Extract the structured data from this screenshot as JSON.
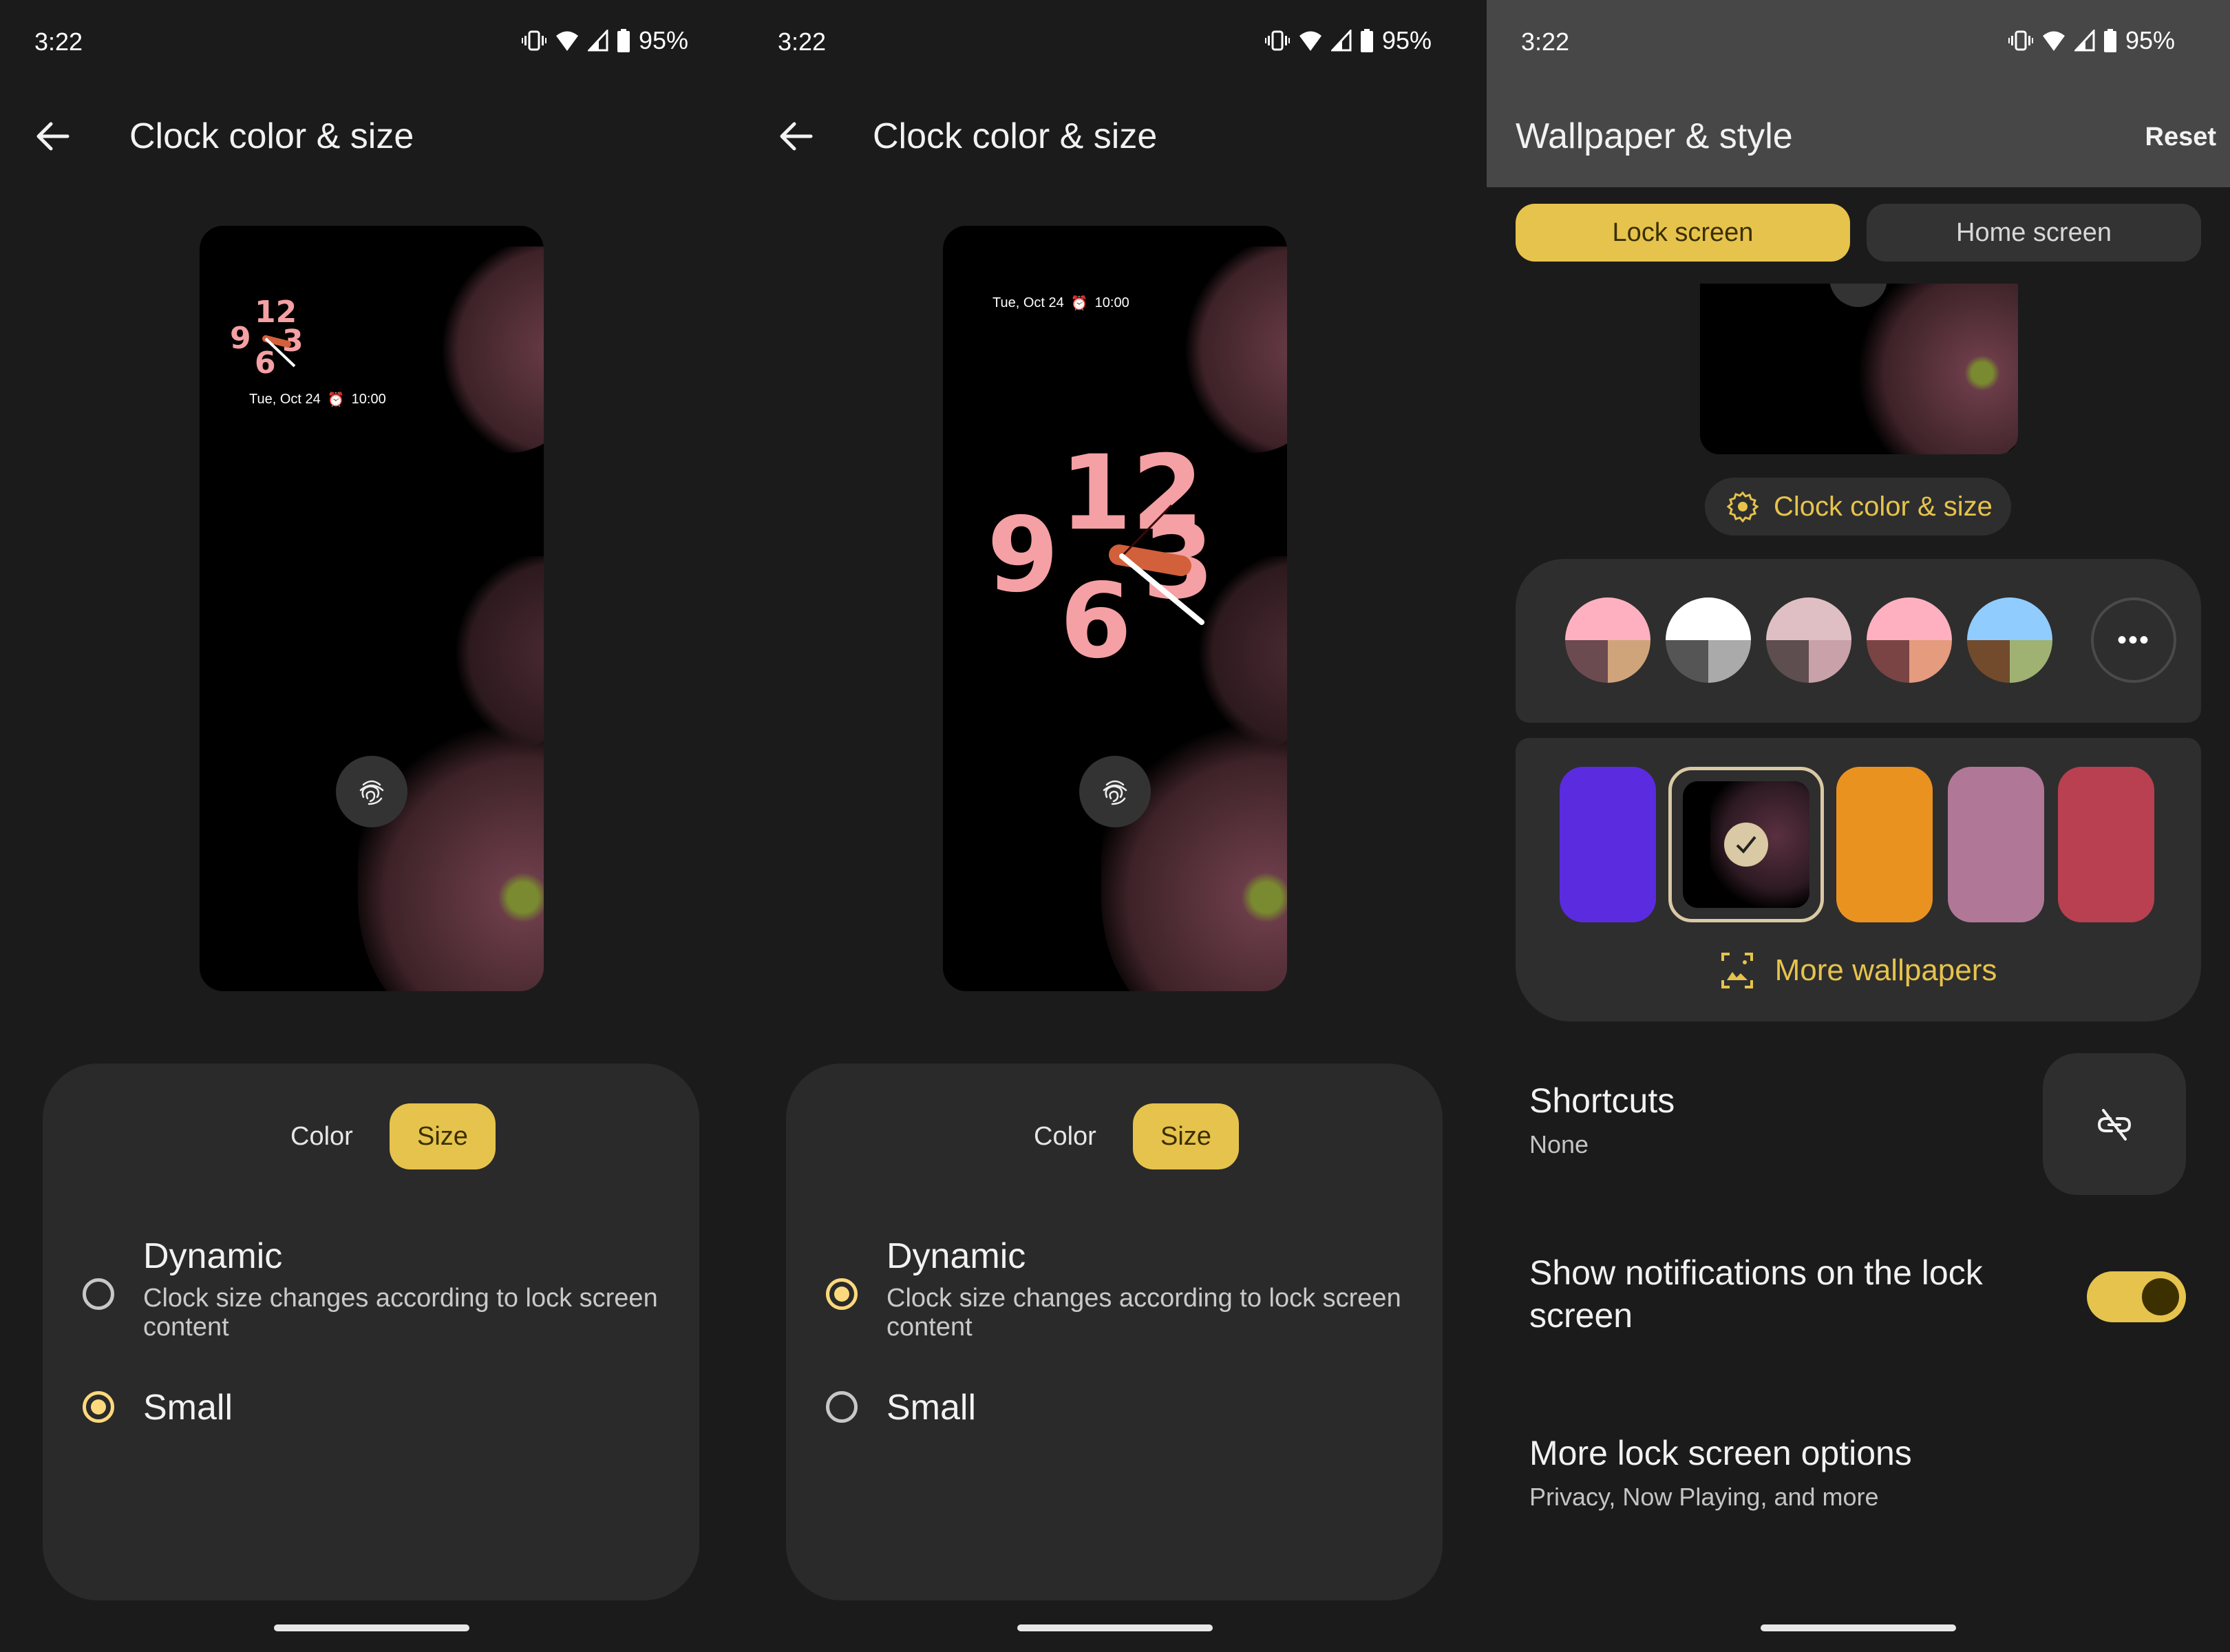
{
  "status_bar": {
    "time": "3:22",
    "battery": "95%",
    "icons": [
      "vibrate-icon",
      "wifi-icon",
      "signal-icon",
      "battery-icon"
    ]
  },
  "accent_color": "#e6c34c",
  "clock_screens": [
    {
      "title": "Clock color & size",
      "preview": {
        "date": "Tue, Oct 24",
        "alarm": "10:00",
        "clock_numerals": [
          "12",
          "9",
          "3",
          "6"
        ],
        "clock_size": "small"
      },
      "tabs": [
        {
          "label": "Color",
          "selected": false
        },
        {
          "label": "Size",
          "selected": true
        }
      ],
      "options": [
        {
          "label": "Dynamic",
          "description": "Clock size changes according to lock screen content",
          "selected": false
        },
        {
          "label": "Small",
          "selected": true
        }
      ]
    },
    {
      "title": "Clock color & size",
      "preview": {
        "date": "Tue, Oct 24",
        "alarm": "10:00",
        "clock_numerals": [
          "12",
          "9",
          "3",
          "6"
        ],
        "clock_size": "large"
      },
      "tabs": [
        {
          "label": "Color",
          "selected": false
        },
        {
          "label": "Size",
          "selected": true
        }
      ],
      "options": [
        {
          "label": "Dynamic",
          "description": "Clock size changes according to lock screen content",
          "selected": true
        },
        {
          "label": "Small",
          "selected": false
        }
      ]
    }
  ],
  "wallpaper_screen": {
    "title": "Wallpaper & style",
    "reset_label": "Reset",
    "tabs": [
      {
        "label": "Lock screen",
        "selected": true
      },
      {
        "label": "Home screen",
        "selected": false
      }
    ],
    "clock_button_label": "Clock color & size",
    "color_options": [
      {
        "top": "#ffb0c0",
        "bottom_left": "#6b4a50",
        "bottom_right": "#d0a47a"
      },
      {
        "top": "#ffffff",
        "bottom_left": "#555555",
        "bottom_right": "#aaaaaa"
      },
      {
        "top": "#dfbfc4",
        "bottom_left": "#5e4e50",
        "bottom_right": "#c8a2a8"
      },
      {
        "top": "#ffb0c0",
        "bottom_left": "#7a4444",
        "bottom_right": "#e59b7e"
      },
      {
        "top": "#90ccfe",
        "bottom_left": "#724a2c",
        "bottom_right": "#a0b272"
      }
    ],
    "more_colors_label": "•••",
    "wallpapers": [
      {
        "color": "#5b2be0",
        "selected": false
      },
      {
        "color": "image",
        "selected": true
      },
      {
        "color": "#ea9220",
        "selected": false
      },
      {
        "color": "#b07896",
        "selected": false
      },
      {
        "color": "#b84050",
        "selected": false
      }
    ],
    "more_wallpapers_label": "More wallpapers",
    "shortcuts": {
      "title": "Shortcuts",
      "value": "None"
    },
    "notifications": {
      "title": "Show notifications on the lock screen",
      "enabled": true
    },
    "more_options": {
      "title": "More lock screen options",
      "subtitle": "Privacy, Now Playing, and more"
    }
  }
}
